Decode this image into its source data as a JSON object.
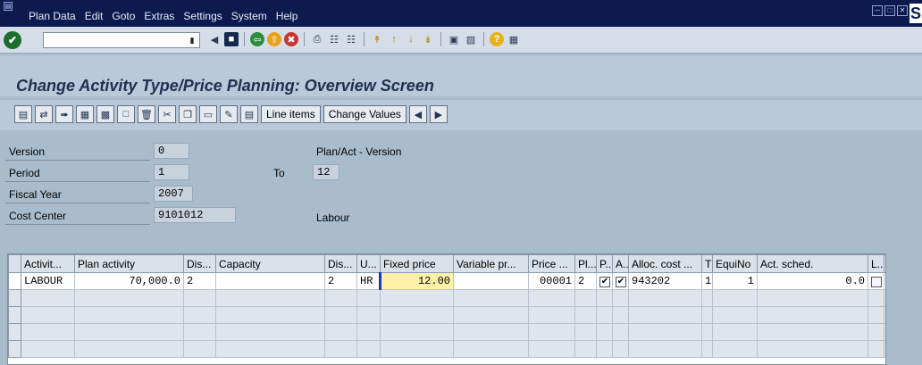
{
  "menu": [
    "Plan Data",
    "Edit",
    "Goto",
    "Extras",
    "Settings",
    "System",
    "Help"
  ],
  "window_buttons": [
    "minimize-icon",
    "maximize-icon",
    "close-icon"
  ],
  "brand": "S",
  "command_field": {
    "value": ""
  },
  "standard_toolbar_icons": [
    "enter-icon",
    "back-icon",
    "exit-icon",
    "cancel-icon",
    "print-icon",
    "find-icon",
    "find-next-icon",
    "first-page-icon",
    "previous-page-icon",
    "next-page-icon",
    "last-page-icon",
    "create-session-icon",
    "shortcut-icon",
    "help-icon",
    "customize-layout-icon"
  ],
  "page_title": "Change Activity Type/Price Planning: Overview Screen",
  "app_toolbar": {
    "line_items_label": "Line items",
    "change_values_label": "Change Values"
  },
  "header": {
    "version_label": "Version",
    "version_value": "0",
    "version_desc": "Plan/Act - Version",
    "period_label": "Period",
    "period_from": "1",
    "to_label": "To",
    "period_to": "12",
    "fiscal_year_label": "Fiscal Year",
    "fiscal_year_value": "2007",
    "cost_center_label": "Cost Center",
    "cost_center_value": "9101012",
    "cost_center_desc": "Labour"
  },
  "table": {
    "columns": [
      "Activit...",
      "Plan activity",
      "Dis...",
      "Capacity",
      "Dis...",
      "U...",
      "Fixed price",
      "Variable pr...",
      "Price ...",
      "Pl...",
      "P...",
      "A...",
      "Alloc. cost ...",
      "T",
      "EquiNo",
      "Act. sched.",
      "L..."
    ],
    "row": {
      "activity": "LABOUR",
      "plan_activity": "70,000.0",
      "dis1": "2",
      "capacity": "",
      "dis2": "2",
      "unit": "HR",
      "fixed_price": "12.00",
      "variable_price": "",
      "price_unit": "00001",
      "pl": "2",
      "p_checked": true,
      "a_checked": true,
      "alloc_cost": "943202",
      "t": "1",
      "equino": "1",
      "act_sched": "0.0",
      "l_checked": false
    }
  },
  "colors": {
    "titlebar": "#0c1a4e",
    "background": "#a9bccb",
    "title_text": "#1d3050",
    "focus_cell": "#fff2a8"
  }
}
